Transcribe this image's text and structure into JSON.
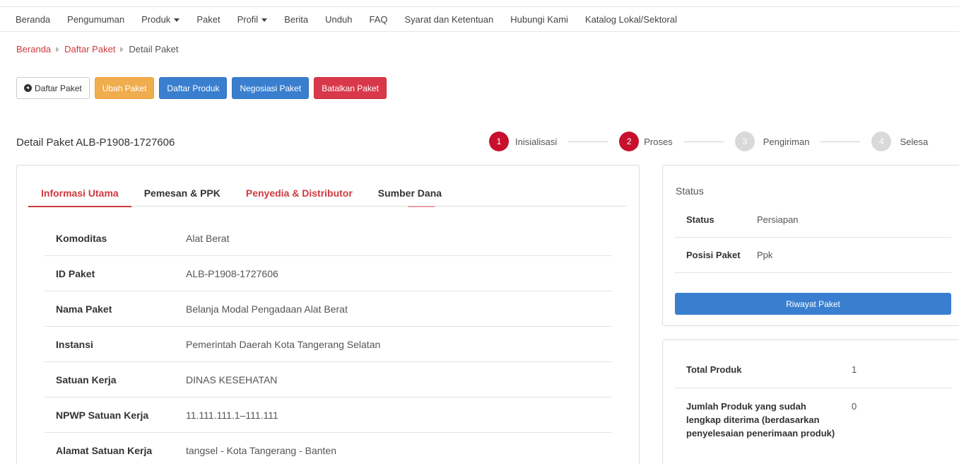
{
  "nav": {
    "items": [
      {
        "label": "Beranda",
        "dropdown": false
      },
      {
        "label": "Pengumuman",
        "dropdown": false
      },
      {
        "label": "Produk",
        "dropdown": true
      },
      {
        "label": "Paket",
        "dropdown": false
      },
      {
        "label": "Profil",
        "dropdown": true
      },
      {
        "label": "Berita",
        "dropdown": false
      },
      {
        "label": "Unduh",
        "dropdown": false
      },
      {
        "label": "FAQ",
        "dropdown": false
      },
      {
        "label": "Syarat dan Ketentuan",
        "dropdown": false
      },
      {
        "label": "Hubungi Kami",
        "dropdown": false
      },
      {
        "label": "Katalog Lokal/Sektoral",
        "dropdown": false
      }
    ]
  },
  "breadcrumb": {
    "home": "Beranda",
    "list": "Daftar Paket",
    "current": "Detail Paket"
  },
  "actions": {
    "back": "Daftar Paket",
    "edit": "Ubah Paket",
    "products": "Daftar Produk",
    "negotiate": "Negosiasi Paket",
    "cancel": "Batalkan Paket"
  },
  "detail_title": "Detail Paket ALB-P1908-1727606",
  "stepper": {
    "steps": [
      {
        "num": "1",
        "label": "Inisialisasi",
        "active": true
      },
      {
        "num": "2",
        "label": "Proses",
        "active": true
      },
      {
        "num": "3",
        "label": "Pengiriman",
        "active": false
      },
      {
        "num": "4",
        "label": "Selesa",
        "active": false
      }
    ]
  },
  "tabs": {
    "info": "Informasi Utama",
    "pemesan": "Pemesan & PPK",
    "penyedia": "Penyedia & Distributor",
    "dana": "Sumber Dana"
  },
  "info": {
    "rows": [
      {
        "key": "Komoditas",
        "value": "Alat Berat"
      },
      {
        "key": "ID Paket",
        "value": "ALB-P1908-1727606"
      },
      {
        "key": "Nama Paket",
        "value": "Belanja Modal Pengadaan Alat Berat"
      },
      {
        "key": "Instansi",
        "value": "Pemerintah Daerah Kota Tangerang Selatan"
      },
      {
        "key": "Satuan Kerja",
        "value": "DINAS KESEHATAN"
      },
      {
        "key": "NPWP Satuan Kerja",
        "value": "11.111.111.1–111.111"
      },
      {
        "key": "Alamat Satuan Kerja",
        "value": "tangsel - Kota Tangerang - Banten"
      }
    ]
  },
  "status_card": {
    "heading": "Status",
    "rows": [
      {
        "key": "Status",
        "value": "Persiapan"
      },
      {
        "key": "Posisi Paket",
        "value": "Ppk"
      }
    ],
    "button": "Riwayat Paket"
  },
  "produk_card": {
    "total_label": "Total Produk",
    "total_value": "1",
    "received_label": "Jumlah Produk yang sudah lengkap diterima (berdasarkan penyelesaian penerimaan produk)",
    "received_value": "0"
  },
  "colors": {
    "brand_red": "#d0393e",
    "primary_blue": "#3a7fcf",
    "warning_orange": "#f0ad4e",
    "danger_red": "#d9384a"
  }
}
